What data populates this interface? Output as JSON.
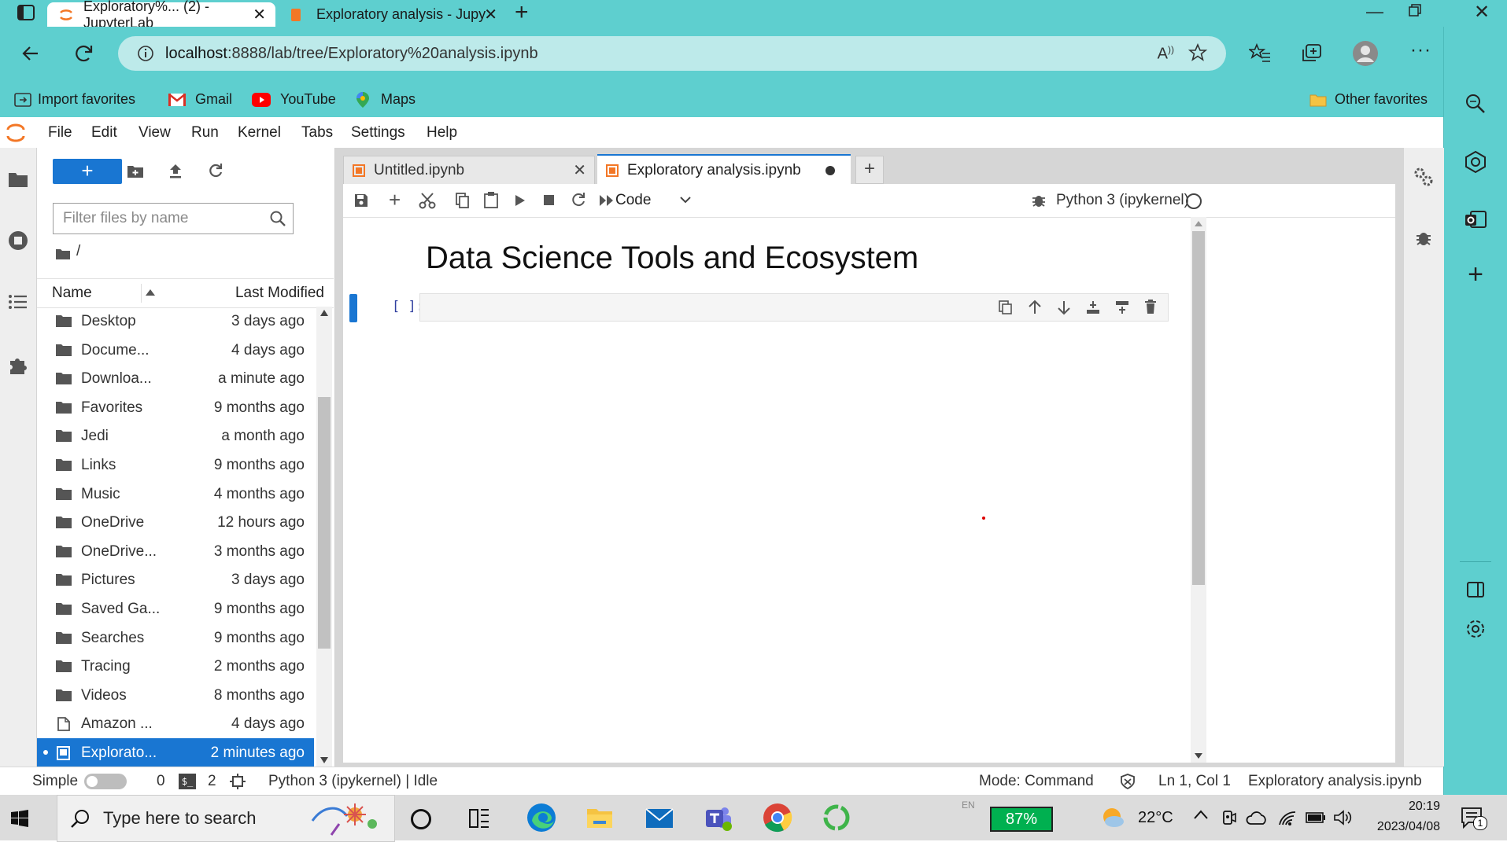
{
  "browser": {
    "tabs": [
      {
        "title": "Exploratory%... (2) - JupyterLab",
        "active": true
      },
      {
        "title": "Exploratory analysis - Jupyter No",
        "active": false
      }
    ],
    "url_host": "localhost",
    "url_path": ":8888/lab/tree/Exploratory%20analysis.ipynb",
    "favorites": [
      "Import favorites",
      "Gmail",
      "YouTube",
      "Maps"
    ],
    "other_favorites": "Other favorites"
  },
  "jupyter": {
    "menu": [
      "File",
      "Edit",
      "View",
      "Run",
      "Kernel",
      "Tabs",
      "Settings",
      "Help"
    ],
    "filter_placeholder": "Filter files by name",
    "breadcrumb": "/",
    "columns": {
      "name": "Name",
      "modified": "Last Modified"
    },
    "files": [
      {
        "name": "Desktop",
        "modified": "3 days ago",
        "type": "folder"
      },
      {
        "name": "Docume...",
        "modified": "4 days ago",
        "type": "folder"
      },
      {
        "name": "Downloa...",
        "modified": "a minute ago",
        "type": "folder"
      },
      {
        "name": "Favorites",
        "modified": "9 months ago",
        "type": "folder"
      },
      {
        "name": "Jedi",
        "modified": "a month ago",
        "type": "folder"
      },
      {
        "name": "Links",
        "modified": "9 months ago",
        "type": "folder"
      },
      {
        "name": "Music",
        "modified": "4 months ago",
        "type": "folder"
      },
      {
        "name": "OneDrive",
        "modified": "12 hours ago",
        "type": "folder"
      },
      {
        "name": "OneDrive...",
        "modified": "3 months ago",
        "type": "folder"
      },
      {
        "name": "Pictures",
        "modified": "3 days ago",
        "type": "folder"
      },
      {
        "name": "Saved Ga...",
        "modified": "9 months ago",
        "type": "folder"
      },
      {
        "name": "Searches",
        "modified": "9 months ago",
        "type": "folder"
      },
      {
        "name": "Tracing",
        "modified": "2 months ago",
        "type": "folder"
      },
      {
        "name": "Videos",
        "modified": "8 months ago",
        "type": "folder"
      },
      {
        "name": "Amazon ...",
        "modified": "4 days ago",
        "type": "file"
      },
      {
        "name": "Explorato...",
        "modified": "2 minutes ago",
        "type": "notebook",
        "selected": true
      }
    ],
    "doc_tabs": [
      {
        "title": "Untitled.ipynb"
      },
      {
        "title": "Exploratory analysis.ipynb"
      }
    ],
    "cell_type": "Code",
    "kernel": "Python 3 (ipykernel)",
    "heading": "Data Science Tools and Ecosystem",
    "prompt": "[ ]:",
    "status": {
      "simple": "Simple",
      "terminals": "0",
      "kernels": "2",
      "kernel_status": "Python 3 (ipykernel) | Idle",
      "mode": "Mode: Command",
      "position": "Ln 1, Col 1",
      "filename": "Exploratory analysis.ipynb"
    }
  },
  "taskbar": {
    "search_placeholder": "Type here to search",
    "lang": "EN",
    "battery": "87%",
    "temperature": "22°C",
    "time": "20:19",
    "date": "2023/04/08",
    "notification_count": "1"
  }
}
